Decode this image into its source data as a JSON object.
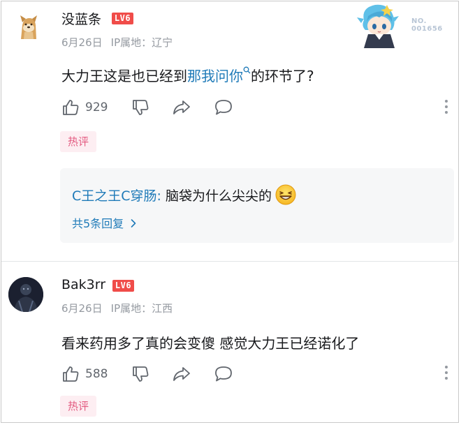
{
  "comments": [
    {
      "username": "没蓝条",
      "level": "LV6",
      "date": "6月26日",
      "ip_location": "IP属地：辽宁",
      "text_before": "大力王这是也已经到",
      "keyword": "那我问你",
      "text_after": "的环节了?",
      "likes": "929",
      "hot_label": "热评",
      "fan_badge": {
        "label": "NO.",
        "number": "001656"
      },
      "sub_reply": {
        "user": "C王之王C穿肠",
        "separator": ": ",
        "text": "脑袋为什么尖尖的",
        "emoji": "grinning-squint-emoji"
      },
      "view_replies": "共5条回复"
    },
    {
      "username": "Bak3rr",
      "level": "LV6",
      "date": "6月26日",
      "ip_location": "IP属地：江西",
      "text": "看来药用多了真的会变傻 感觉大力王已经诺化了",
      "likes": "588",
      "hot_label": "热评"
    }
  ],
  "icons": {
    "like": "thumbs-up-icon",
    "dislike": "thumbs-down-icon",
    "share": "share-icon",
    "reply": "comment-icon",
    "more": "more-vertical-icon",
    "search": "search-icon"
  },
  "colors": {
    "link": "#1e7ab8",
    "level_badge": "#f04c49",
    "hot_tag_bg": "#fdeef2",
    "hot_tag_text": "#e35b81",
    "meta": "#9499a0"
  }
}
